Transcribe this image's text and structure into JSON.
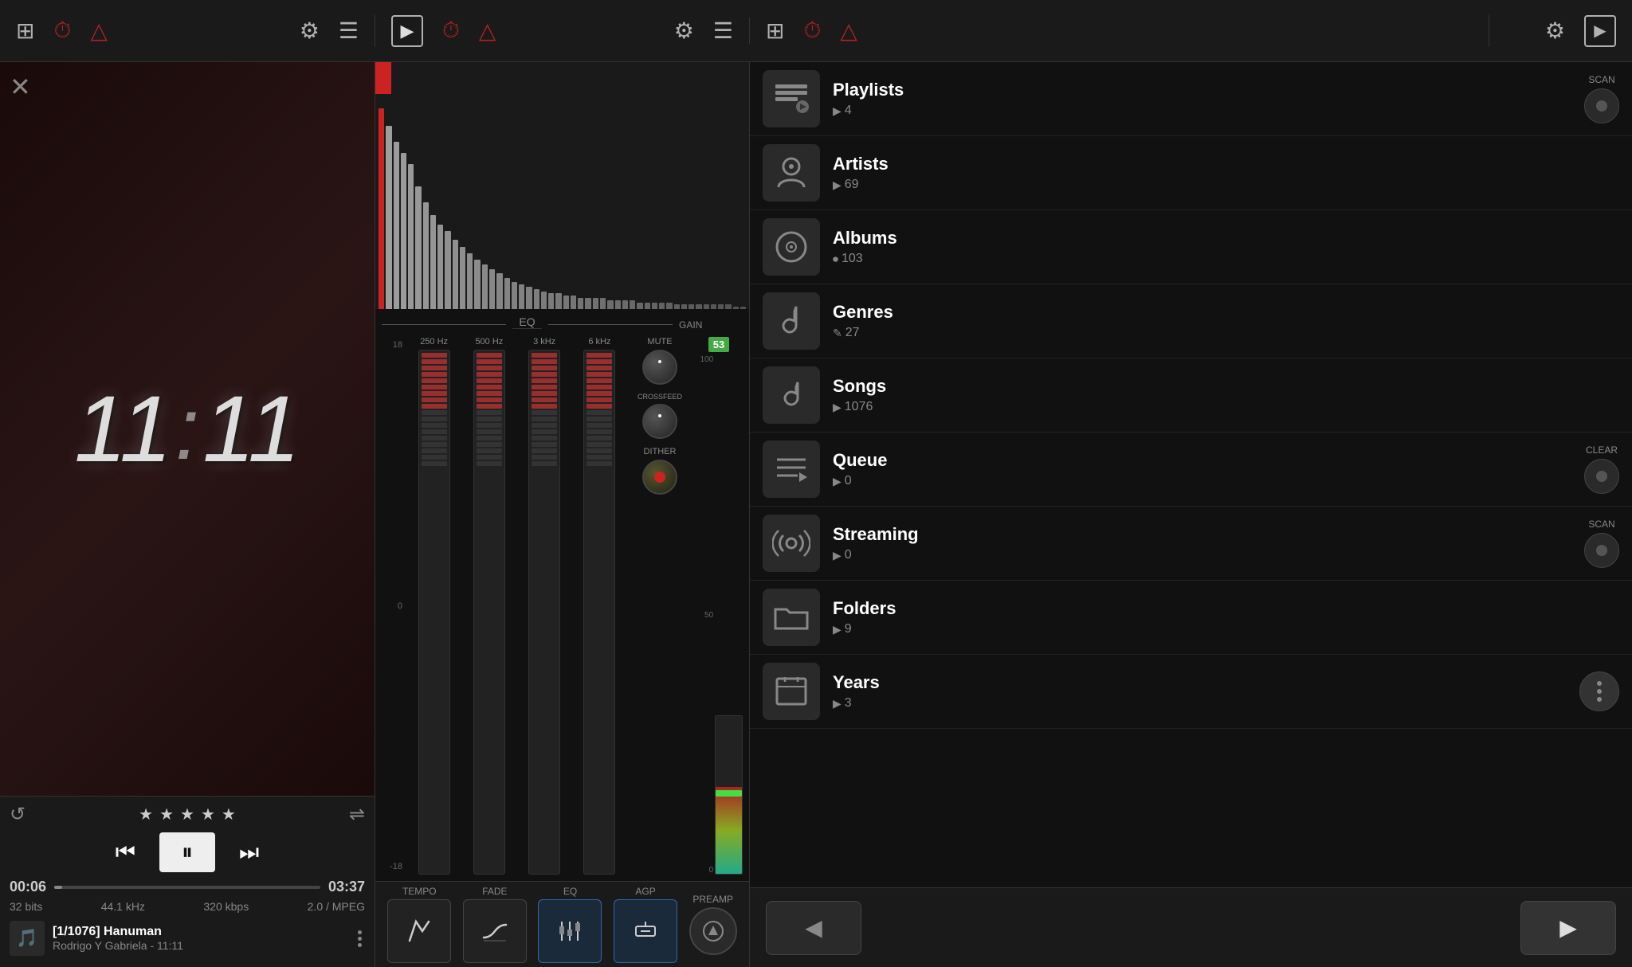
{
  "topBar": {
    "leftIcons": [
      "equalizer",
      "clock",
      "bell"
    ],
    "leftRightIcons": [
      "gear",
      "menu"
    ],
    "midIcons": [
      "play",
      "clock",
      "bell"
    ],
    "midRightIcons": [
      "gear",
      "menu"
    ],
    "mid2Icons": [
      "equalizer",
      "clock",
      "bell"
    ],
    "rightIcons": [
      "gear",
      "play"
    ]
  },
  "clock": {
    "time": "11:11"
  },
  "player": {
    "currentTime": "00:06",
    "totalTime": "03:37",
    "bitDepth": "32 bits",
    "sampleRate": "44.1 kHz",
    "bitrate": "320 kbps",
    "format": "2.0 / MPEG",
    "trackNumber": "[1/1076]",
    "trackTitle": "Hanuman",
    "trackArtist": "Rodrigo Y Gabriela - 11:11",
    "stars": [
      "★",
      "★",
      "★",
      "★",
      "★"
    ],
    "progressPercent": 3
  },
  "eq": {
    "label": "EQ",
    "gainLabel": "GAIN",
    "gainValue": "53",
    "muteLabel": "MUTE",
    "crossfeedLabel": "CROSSFEED",
    "ditherLabel": "DITHER",
    "bands": [
      {
        "freq": "250 Hz"
      },
      {
        "freq": "500 Hz"
      },
      {
        "freq": "3 kHz"
      },
      {
        "freq": "6 kHz"
      }
    ],
    "scaleTop": "18",
    "scaleZero": "0",
    "scaleBot": "-18",
    "gainScaleTop": "100",
    "gainScaleZero": "50",
    "gainScaleBot": "0"
  },
  "toolbar": {
    "buttons": [
      {
        "label": "TEMPO",
        "icon": "~"
      },
      {
        "label": "FADE",
        "icon": "≈"
      },
      {
        "label": "EQ",
        "icon": "≡"
      },
      {
        "label": "AGP",
        "icon": "⌐"
      },
      {
        "label": "PREAMP",
        "icon": "▶"
      }
    ]
  },
  "library": {
    "items": [
      {
        "name": "Playlists",
        "count": "4",
        "icon": "≡",
        "action": "SCAN",
        "actionType": "scan"
      },
      {
        "name": "Artists",
        "count": "69",
        "icon": "🎤",
        "action": null,
        "actionType": null
      },
      {
        "name": "Albums",
        "count": "103",
        "icon": "⏺",
        "action": null,
        "actionType": null
      },
      {
        "name": "Genres",
        "count": "27",
        "icon": "🎸",
        "action": null,
        "actionType": null
      },
      {
        "name": "Songs",
        "count": "1076",
        "icon": "🎵",
        "action": null,
        "actionType": null
      },
      {
        "name": "Queue",
        "count": "0",
        "icon": "≫",
        "action": "CLEAR",
        "actionType": "clear"
      },
      {
        "name": "Streaming",
        "count": "0",
        "icon": "📡",
        "action": "SCAN",
        "actionType": "scan"
      },
      {
        "name": "Folders",
        "count": "9",
        "icon": "📁",
        "action": null,
        "actionType": null
      },
      {
        "name": "Years",
        "count": "3",
        "icon": "⏺",
        "action": null,
        "actionType": "dots"
      }
    ]
  },
  "bottomNav": {
    "backLabel": "◀",
    "forwardLabel": "▶"
  }
}
